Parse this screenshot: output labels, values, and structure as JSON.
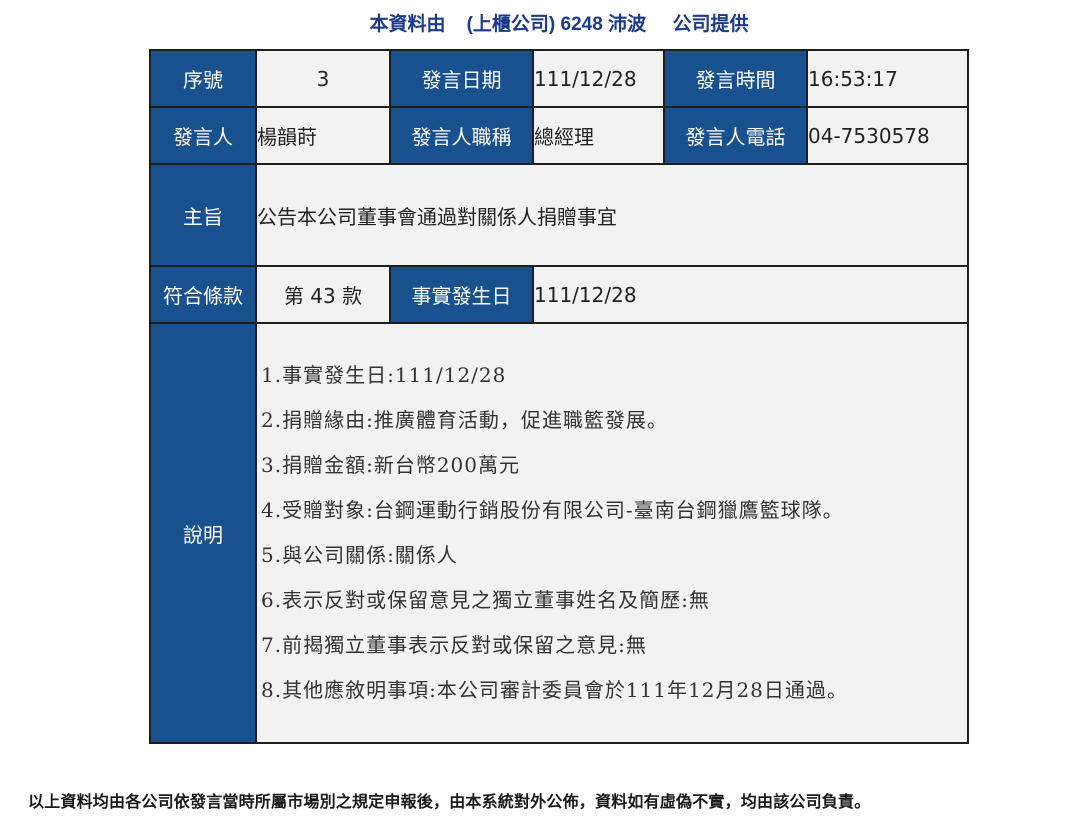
{
  "header": {
    "prefix": "本資料由",
    "company": "(上櫃公司) 6248 沛波",
    "suffix": "公司提供"
  },
  "row1": {
    "seq_label": "序號",
    "seq_value": "3",
    "date_label": "發言日期",
    "date_value": "111/12/28",
    "time_label": "發言時間",
    "time_value": "16:53:17"
  },
  "row2": {
    "speaker_label": "發言人",
    "speaker_value": "楊韻莳",
    "title_label": "發言人職稱",
    "title_value": "總經理",
    "phone_label": "發言人電話",
    "phone_value": "04-7530578"
  },
  "row3": {
    "subject_label": "主旨",
    "subject_value": "公告本公司董事會通過對關係人捐贈事宜"
  },
  "row4": {
    "clause_label": "符合條款",
    "clause_value": "第 43 款",
    "event_date_label": "事實發生日",
    "event_date_value": "111/12/28"
  },
  "row5": {
    "desc_label": "說明",
    "lines": [
      "1.事實發生日:111/12/28",
      "2.捐贈緣由:推廣體育活動，促進職籃發展。",
      "3.捐贈金額:新台幣200萬元",
      "4.受贈對象:台鋼運動行銷股份有限公司-臺南台鋼獵鷹籃球隊。",
      "5.與公司關係:關係人",
      "6.表示反對或保留意見之獨立董事姓名及簡歷:無",
      "7.前揭獨立董事表示反對或保留之意見:無",
      "8.其他應敘明事項:本公司審計委員會於111年12月28日通過。"
    ]
  },
  "footer": {
    "disclaimer": "以上資料均由各公司依發言當時所屬市場別之規定申報後，由本系統對外公佈，資料如有虛偽不實，均由該公司負責。"
  },
  "colors": {
    "label_bg": "#19508e",
    "value_bg": "#f2f2f2",
    "header_text": "#1b3a8c"
  }
}
